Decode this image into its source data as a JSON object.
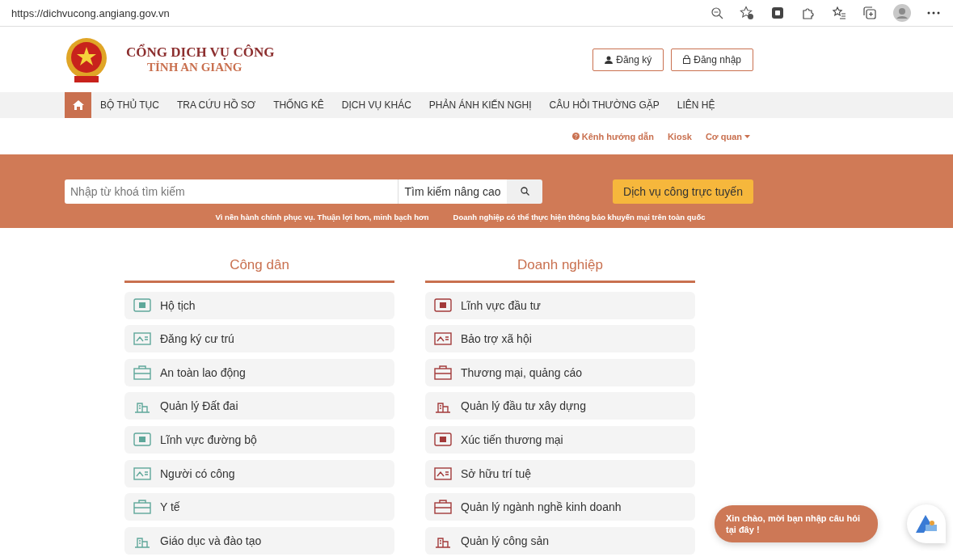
{
  "browser": {
    "url": "https://dichvucong.angiang.gov.vn"
  },
  "header": {
    "title": "CỔNG DỊCH VỤ CÔNG",
    "subtitle": "TỈNH AN GIANG",
    "buttons": [
      {
        "kind": "register",
        "label": "Đăng ký"
      },
      {
        "kind": "login",
        "label": "Đăng nhập"
      }
    ]
  },
  "nav": {
    "items": [
      {
        "kind": "home",
        "selected": true
      },
      {
        "kind": "text",
        "label": "BỘ THỦ TỤC",
        "selected": false
      },
      {
        "kind": "text",
        "label": "TRA CỨU HỒ SƠ",
        "selected": false
      },
      {
        "kind": "text",
        "label": "THỐNG KÊ",
        "selected": false
      },
      {
        "kind": "text",
        "label": "DỊCH VỤ KHÁC",
        "selected": false
      },
      {
        "kind": "text",
        "label": "PHẢN ÁNH KIẾN NGHỊ",
        "selected": false
      },
      {
        "kind": "text",
        "label": "CÂU HỎI THƯỜNG GẶP",
        "selected": false
      },
      {
        "kind": "text",
        "label": "LIÊN HỆ",
        "selected": false
      }
    ]
  },
  "sublinks": [
    {
      "kind": "help",
      "label": "Kênh hướng dẫn"
    },
    {
      "kind": "plain",
      "label": "Kiosk"
    },
    {
      "kind": "dropdown",
      "label": "Cơ quan"
    }
  ],
  "banner": {
    "search": {
      "placeholder": "Nhập từ khoá tìm kiếm"
    },
    "advanced": "Tìm kiếm nâng cao",
    "online_button": "Dịch vụ công trực tuyến",
    "taglines": [
      "Vì nền hành chính phục vụ. Thuận lợi hơn, minh bạch hơn",
      "Doanh nghiệp có thể thực hiện thông báo khuyến mại trên toàn quốc"
    ]
  },
  "categories": [
    {
      "title": "Công dân",
      "color": "#5fa79a",
      "items": [
        "Hộ tịch",
        "Đăng ký cư trú",
        "An toàn lao động",
        "Quản lý Đất đai",
        "Lĩnh vực đường bộ",
        "Người có công",
        "Y tế",
        "Giáo dục và đào tạo"
      ]
    },
    {
      "title": "Doanh nghiệp",
      "color": "#a23a3a",
      "items": [
        "Lĩnh vực đầu tư",
        "Bảo trợ xã hội",
        "Thương mại, quảng cáo",
        "Quản lý đầu tư xây dựng",
        "Xúc tiến thương mại",
        "Sở hữu trí tuệ",
        "Quản lý ngành nghề kinh doanh",
        "Quản lý công sản"
      ]
    }
  ],
  "chat": {
    "message": "Xin chào, mời bạn nhập câu hỏi tại đây !"
  }
}
